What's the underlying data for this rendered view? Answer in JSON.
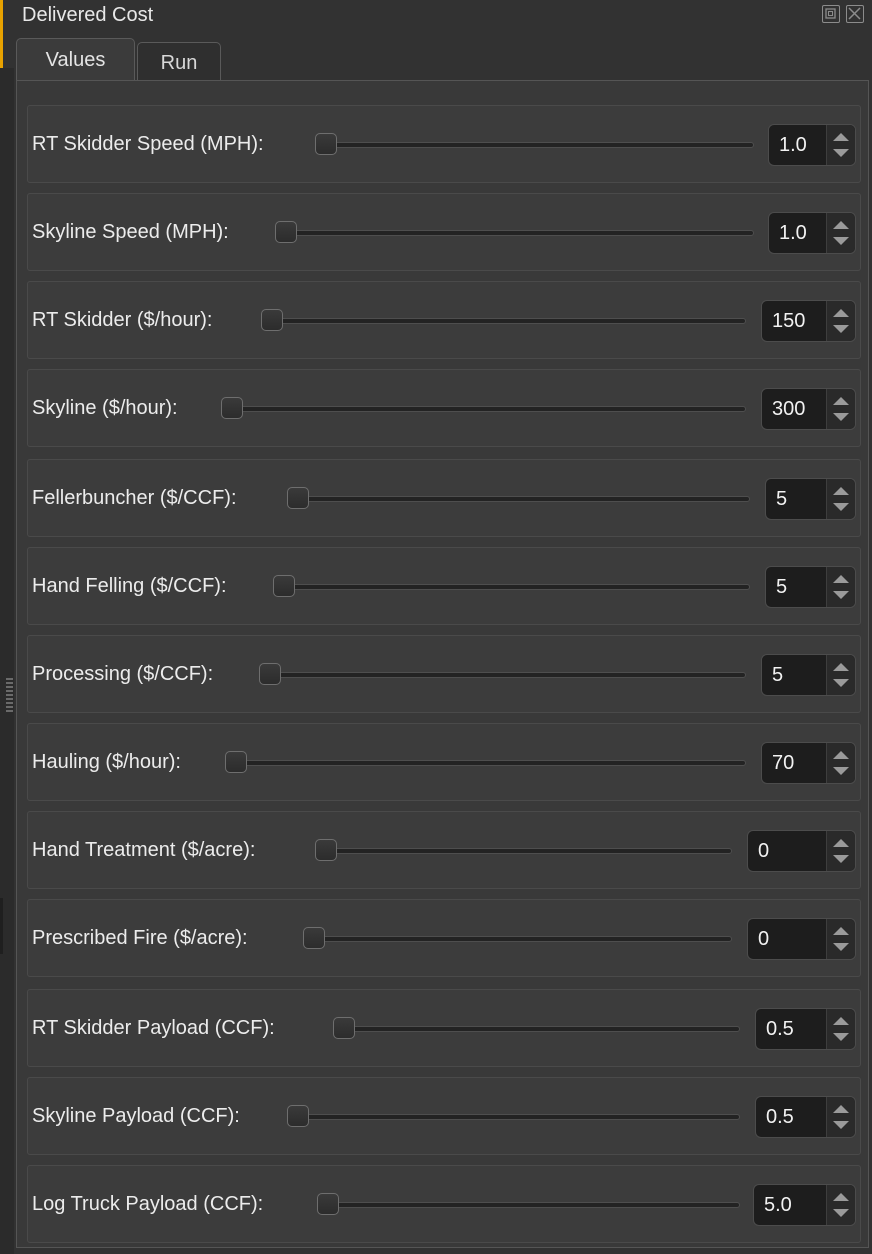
{
  "window": {
    "title": "Delivered Cost",
    "float_icon": "float-window-icon",
    "close_icon": "close-icon"
  },
  "tabs": [
    {
      "label": "Values"
    },
    {
      "label": "Run"
    }
  ],
  "colors": {
    "accent": "#e8a200",
    "background": "#323232",
    "panel": "#393939"
  },
  "fields": [
    {
      "label": "RT Skidder Speed (MPH):",
      "value": "1.0"
    },
    {
      "label": "Skyline Speed (MPH):",
      "value": "1.0"
    },
    {
      "label": "RT Skidder ($/hour):",
      "value": "150"
    },
    {
      "label": "Skyline ($/hour):",
      "value": "300"
    },
    {
      "label": "Fellerbuncher ($/CCF):",
      "value": "5"
    },
    {
      "label": "Hand Felling ($/CCF):",
      "value": "5"
    },
    {
      "label": "Processing ($/CCF):",
      "value": "5"
    },
    {
      "label": "Hauling ($/hour):",
      "value": "70"
    },
    {
      "label": "Hand Treatment ($/acre):",
      "value": "0"
    },
    {
      "label": "Prescribed Fire ($/acre):",
      "value": "0"
    },
    {
      "label": "RT Skidder Payload (CCF):",
      "value": "0.5"
    },
    {
      "label": "Skyline Payload (CCF):",
      "value": "0.5"
    },
    {
      "label": "Log Truck Payload (CCF):",
      "value": "5.0"
    }
  ]
}
